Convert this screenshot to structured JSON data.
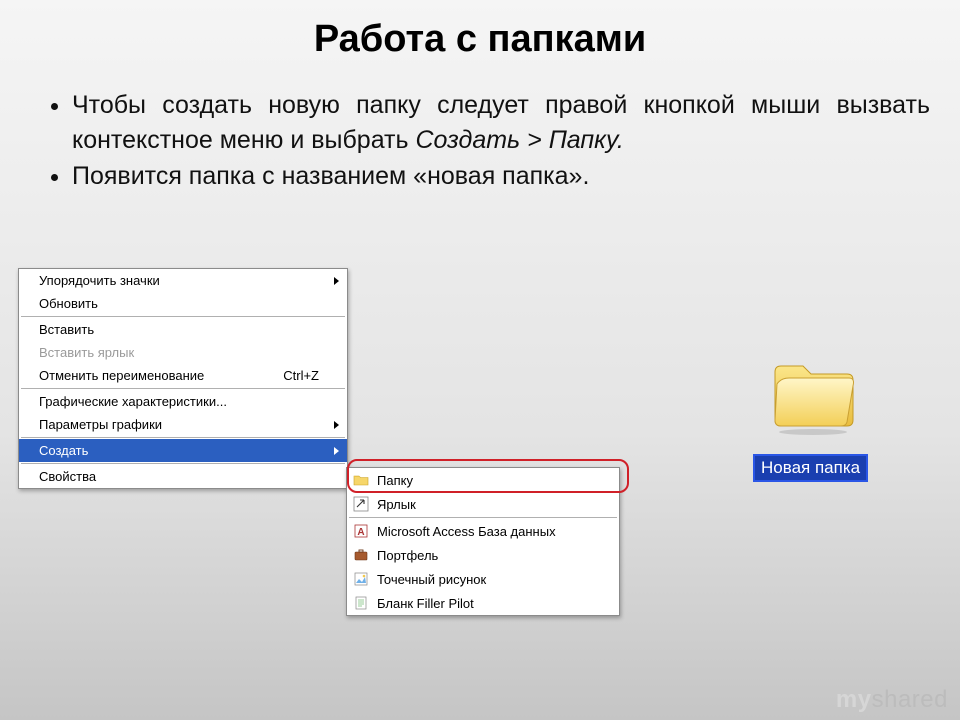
{
  "title": "Работа с папками",
  "bullets": {
    "item1_pre": "Чтобы создать новую папку следует правой кнопкой мыши вызвать контекстное меню и выбрать ",
    "item1_ital": "Создать > Папку.",
    "item2": "Появится папка с названием «новая папка»."
  },
  "context_menu": {
    "arrange": "Упорядочить значки",
    "refresh": "Обновить",
    "paste": "Вставить",
    "paste_shortcut": "Вставить ярлык",
    "undo_rename": "Отменить переименование",
    "undo_key": "Ctrl+Z",
    "graphics_chars": "Графические характеристики...",
    "graphics_params": "Параметры графики",
    "create": "Создать",
    "properties": "Свойства"
  },
  "submenu": {
    "folder": "Папку",
    "shortcut": "Ярлык",
    "access": "Microsoft Access База данных",
    "briefcase": "Портфель",
    "bmp": "Точечный рисунок",
    "filler": "Бланк Filler Pilot"
  },
  "new_folder": {
    "label": "Новая папка"
  },
  "watermark": {
    "my": "my",
    "shared": "shared"
  }
}
